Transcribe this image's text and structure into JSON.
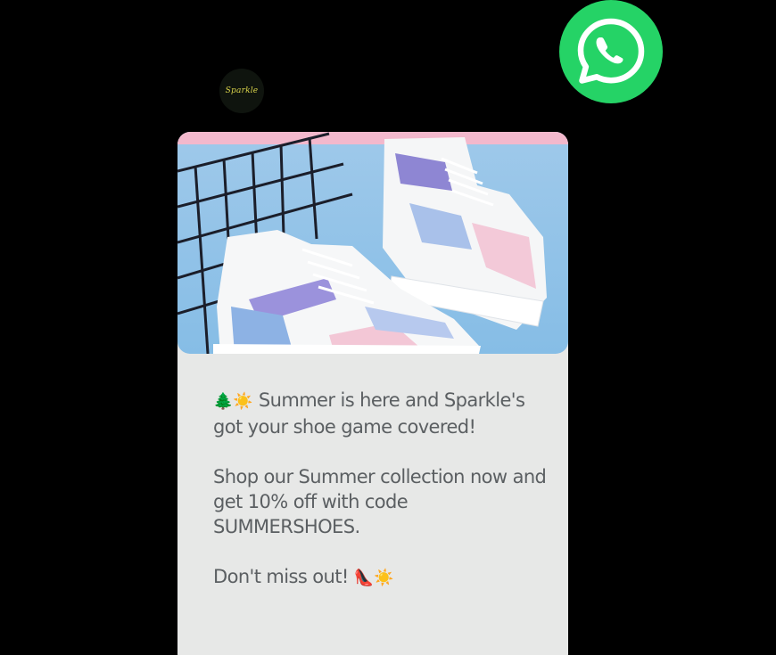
{
  "app": {
    "logo_icon": "whatsapp-icon",
    "logo_color": "#25D366"
  },
  "sender": {
    "name": "Sparkle",
    "avatar_icon": "sparkle-brand-logo"
  },
  "message": {
    "image_description_icon": "sneakers-photo",
    "paragraph1": {
      "emoji": "🌲☀️",
      "text": "Summer is here and Sparkle's got your shoe game covered!"
    },
    "paragraph2": "Shop our Summer collection now and get 10% off with code SUMMERSHOES.",
    "paragraph3": {
      "text": "Don't miss out!",
      "emoji": "👠☀️"
    },
    "bubble_color": "#e7e8e7",
    "text_color": "#5b5f62"
  }
}
